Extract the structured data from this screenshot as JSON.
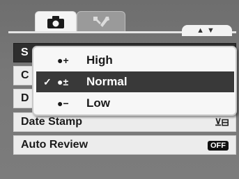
{
  "tabs": [
    {
      "name": "camera-icon",
      "selected": true
    },
    {
      "name": "wrench-icon",
      "selected": false
    }
  ],
  "scroll_indicator": "▲▼",
  "menu_rows": [
    {
      "label": "S",
      "value": ""
    },
    {
      "label": "C",
      "value": ""
    },
    {
      "label": "D",
      "value": ""
    },
    {
      "label": "Date Stamp",
      "value": "⊻⊟"
    },
    {
      "label": "Auto Review",
      "value": "OFF"
    }
  ],
  "popup": {
    "options": [
      {
        "icon": "●+",
        "label": "High",
        "checked": false
      },
      {
        "icon": "●±",
        "label": "Normal",
        "checked": true
      },
      {
        "icon": "●−",
        "label": "Low",
        "checked": false
      }
    ],
    "check_mark": "✓"
  },
  "colors": {
    "selected_bg": "#393939",
    "background": "#777777"
  }
}
